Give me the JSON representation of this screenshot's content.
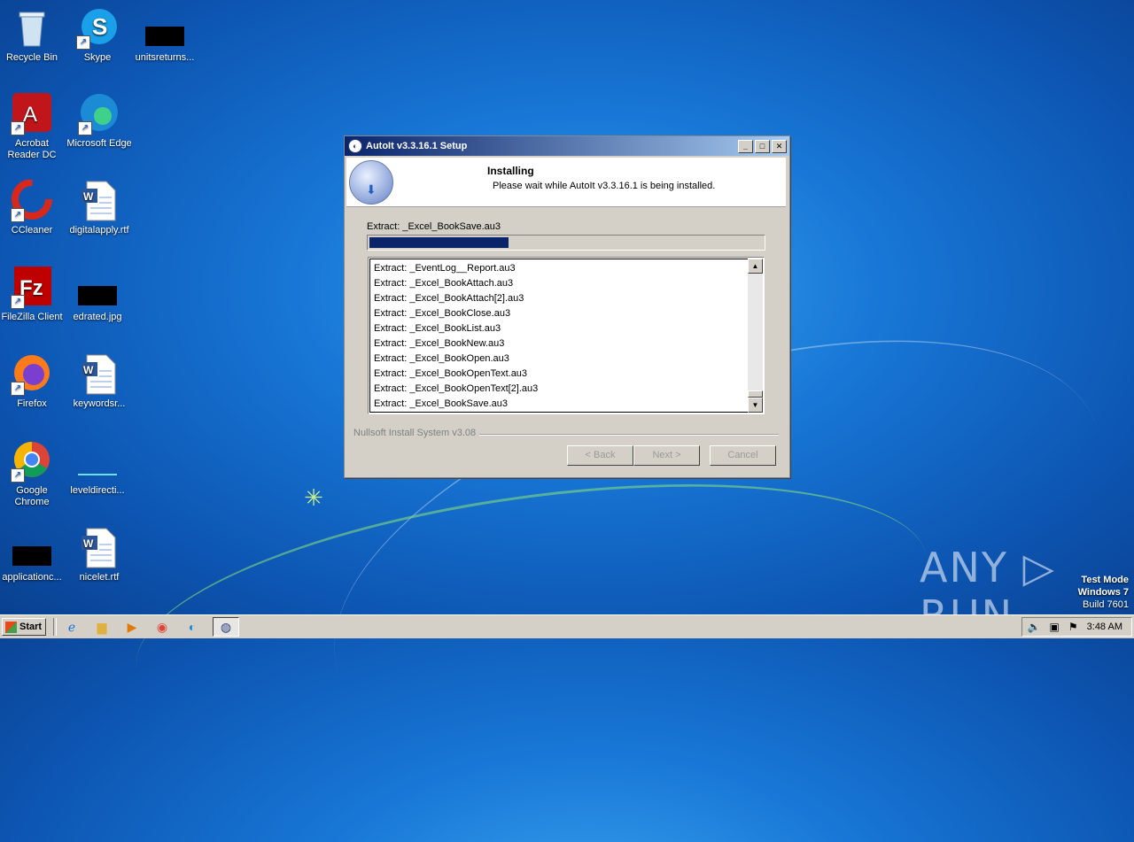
{
  "desktop": {
    "icons": [
      {
        "label": "Recycle Bin",
        "glyph": "🗑"
      },
      {
        "label": "Skype",
        "glyph": "S"
      },
      {
        "label": "unitsreturns...",
        "glyph": ""
      },
      {
        "label": "Acrobat Reader DC",
        "glyph": "A"
      },
      {
        "label": "Microsoft Edge",
        "glyph": "e"
      },
      {
        "label": "CCleaner",
        "glyph": "C"
      },
      {
        "label": "digitalapply.rtf",
        "glyph": "W"
      },
      {
        "label": "FileZilla Client",
        "glyph": "Fz"
      },
      {
        "label": "edrated.jpg",
        "glyph": ""
      },
      {
        "label": "Firefox",
        "glyph": "🦊"
      },
      {
        "label": "keywordsr...",
        "glyph": "W"
      },
      {
        "label": "Google Chrome",
        "glyph": "◉"
      },
      {
        "label": "leveldirecti...",
        "glyph": ""
      },
      {
        "label": "applicationc...",
        "glyph": ""
      },
      {
        "label": "nicelet.rtf",
        "glyph": "W"
      }
    ]
  },
  "dialog": {
    "title": "AutoIt v3.3.16.1 Setup",
    "header_title": "Installing",
    "header_subtitle": "Please wait while AutoIt v3.3.16.1 is being installed.",
    "current_action": "Extract: _Excel_BookSave.au3",
    "progress_fraction": 0.35,
    "log_lines": [
      "Extract: _EventLog__Report.au3",
      "Extract: _Excel_BookAttach.au3",
      "Extract: _Excel_BookAttach[2].au3",
      "Extract: _Excel_BookClose.au3",
      "Extract: _Excel_BookList.au3",
      "Extract: _Excel_BookNew.au3",
      "Extract: _Excel_BookOpen.au3",
      "Extract: _Excel_BookOpenText.au3",
      "Extract: _Excel_BookOpenText[2].au3",
      "Extract: _Excel_BookSave.au3"
    ],
    "branding": "Nullsoft Install System v3.08",
    "buttons": {
      "back": "< Back",
      "next": "Next >",
      "cancel": "Cancel"
    }
  },
  "watermark": {
    "brand": "ANY ▷ RUN",
    "mode_line1": "Test Mode",
    "mode_line2": "Windows 7",
    "mode_line3": "Build 7601"
  },
  "taskbar": {
    "start_label": "Start",
    "clock": "3:48 AM",
    "pinned": [
      "ie-icon",
      "explorer-icon",
      "media-player-icon",
      "chrome-icon",
      "edge-icon",
      "autoit-setup-icon"
    ]
  }
}
